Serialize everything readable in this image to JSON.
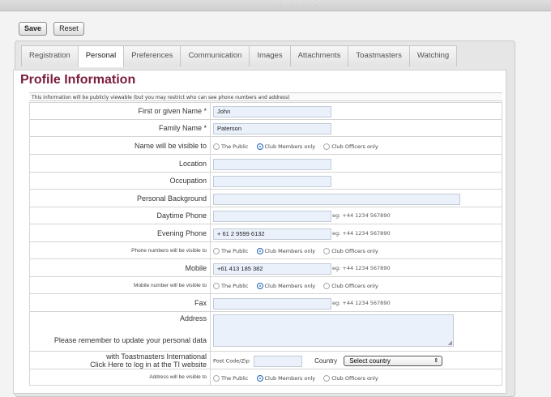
{
  "toolbar": {
    "save_label": "Save",
    "reset_label": "Reset"
  },
  "tabs": [
    "Registration",
    "Personal",
    "Preferences",
    "Communication",
    "Images",
    "Attachments",
    "Toastmasters",
    "Watching"
  ],
  "active_tab": "Personal",
  "profile": {
    "title": "Profile Information",
    "notice": "This information will be publicly viewable (but you may restrict who can see phone numbers and address)"
  },
  "fields": {
    "first_name": {
      "label": "First or given Name *",
      "value": "John"
    },
    "family_name": {
      "label": "Family Name *",
      "value": "Paterson"
    },
    "name_visibility": {
      "label": "Name will be visible to",
      "options": [
        "The Public",
        "Club Members only",
        "Club Officers only"
      ],
      "selected": "Club Members only"
    },
    "location": {
      "label": "Location",
      "value": ""
    },
    "occupation": {
      "label": "Occupation",
      "value": ""
    },
    "background": {
      "label": "Personal Background",
      "value": ""
    },
    "daytime_phone": {
      "label": "Daytime Phone",
      "value": "",
      "hint": "eg: +44 1234 567890"
    },
    "evening_phone": {
      "label": "Evening Phone",
      "value": "+ 61 2 9599 6132",
      "hint": "eg: +44 1234 567890"
    },
    "phone_visibility": {
      "label": "Phone numbers will be visible to",
      "options": [
        "The Public",
        "Club Members only",
        "Club Officers only"
      ],
      "selected": "Club Members only"
    },
    "mobile": {
      "label": "Mobile",
      "value": "+61 413 185 382",
      "hint": "eg: +44 1234 567890"
    },
    "mobile_visibility": {
      "label": "Mobile number will be visible to",
      "options": [
        "The Public",
        "Club Members only",
        "Club Officers only"
      ],
      "selected": "Club Members only"
    },
    "fax": {
      "label": "Fax",
      "value": "",
      "hint": "eg: +44 1234 567890"
    },
    "address": {
      "label": "Address",
      "reminder_line1": "Please remember to update your personal data",
      "reminder_line2": "with Toastmasters International",
      "reminder_line3": "Click Here to log in at the TI website",
      "postcode_label": "Post Code/Zip",
      "country_label": "Country",
      "country_selected": "Select country"
    },
    "address_visibility": {
      "label": "Address will be visible to",
      "options": [
        "The Public",
        "Club Members only",
        "Club Officers only"
      ],
      "selected": "Club Members only"
    }
  },
  "colors": {
    "title": "#7b1e3a",
    "radio_selected": "#3b7fd6",
    "input_bg": "#eaf1fb"
  }
}
